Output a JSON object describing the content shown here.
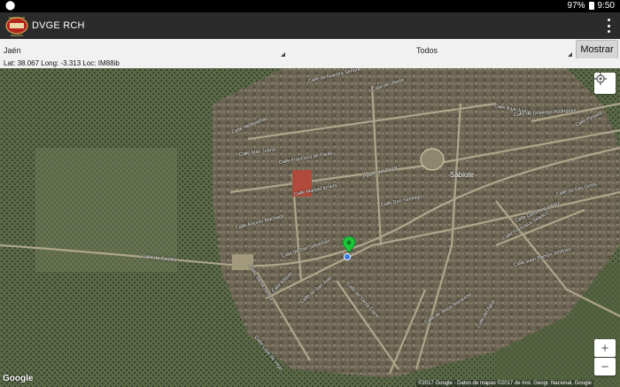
{
  "status": {
    "location_icon": "location-pin-icon",
    "battery": "97%",
    "time": "9:50",
    "battery_icon": "battery-icon"
  },
  "app": {
    "title": "DVGE RCH",
    "logo_top": "RADIO CLUB",
    "logo_bottom": "HENARES",
    "menu_icon": "overflow-menu-icon"
  },
  "filters": {
    "province": "Jaén",
    "type": "Todos",
    "show_button": "Mostrar"
  },
  "coords": {
    "text": "Lat:  38.067  Long:  -3.313  Loc:  IM88ib"
  },
  "map": {
    "town": "Sabiote",
    "attribution": "©2017 Google - Datos de mapas ©2017 de Inst. Geogr. Nacional, Google",
    "provider": "Google",
    "locate_icon": "my-location-icon",
    "zoom_in": "+",
    "zoom_out": "−",
    "marker_color": "#1ec43a",
    "streets": [
      "Calle de Nuestra Señora",
      "Calle de Úbeda",
      "Calle Baja Juana",
      "Calle Valdepeñas",
      "Calle Mari Juana",
      "Calle Francisco de Paula",
      "Calle Manuel Arrieta",
      "Paseo del Ferial",
      "Calle Don Santiago",
      "Calle de Domingo Rodríguez",
      "Calle Pintada",
      "Calle Antonio Machado",
      "Calle de Castillo",
      "Calle de San Ginés",
      "Calle de San Sebastián",
      "Calle Francisco Velasco",
      "Calle Gerónimo Pérez",
      "Calle Santa Teresa",
      "Calle Alferez",
      "Calle de San Juan",
      "Calle de Santa Clara",
      "Calle de Jesús Nazareno",
      "Calle del Agua",
      "Calle Lope de Vega",
      "Calle Juan Ramón Jiménez"
    ]
  }
}
